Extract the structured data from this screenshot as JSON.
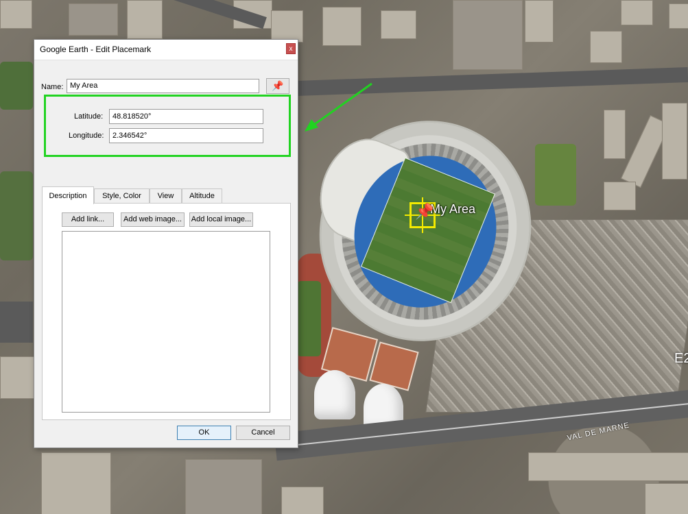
{
  "dialog": {
    "title": "Google Earth - Edit Placemark",
    "close_glyph": "x",
    "name_label": "Name:",
    "name_value": "My Area",
    "pin_icon": "pushpin-icon",
    "latitude_label": "Latitude:",
    "latitude_value": "48.818520°",
    "longitude_label": "Longitude:",
    "longitude_value": "2.346542°",
    "tabs": [
      {
        "label": "Description",
        "active": true
      },
      {
        "label": "Style, Color",
        "active": false
      },
      {
        "label": "View",
        "active": false
      },
      {
        "label": "Altitude",
        "active": false
      }
    ],
    "add_link_label": "Add link...",
    "add_web_image_label": "Add web image...",
    "add_local_image_label": "Add local image...",
    "description_value": "",
    "ok_label": "OK",
    "cancel_label": "Cancel"
  },
  "map": {
    "placemark_label": "My Area",
    "road_label": "VAL DE MARNE",
    "edge_label": "E2",
    "highlight_color": "#21d321",
    "pin_color": "#f3ea00"
  }
}
